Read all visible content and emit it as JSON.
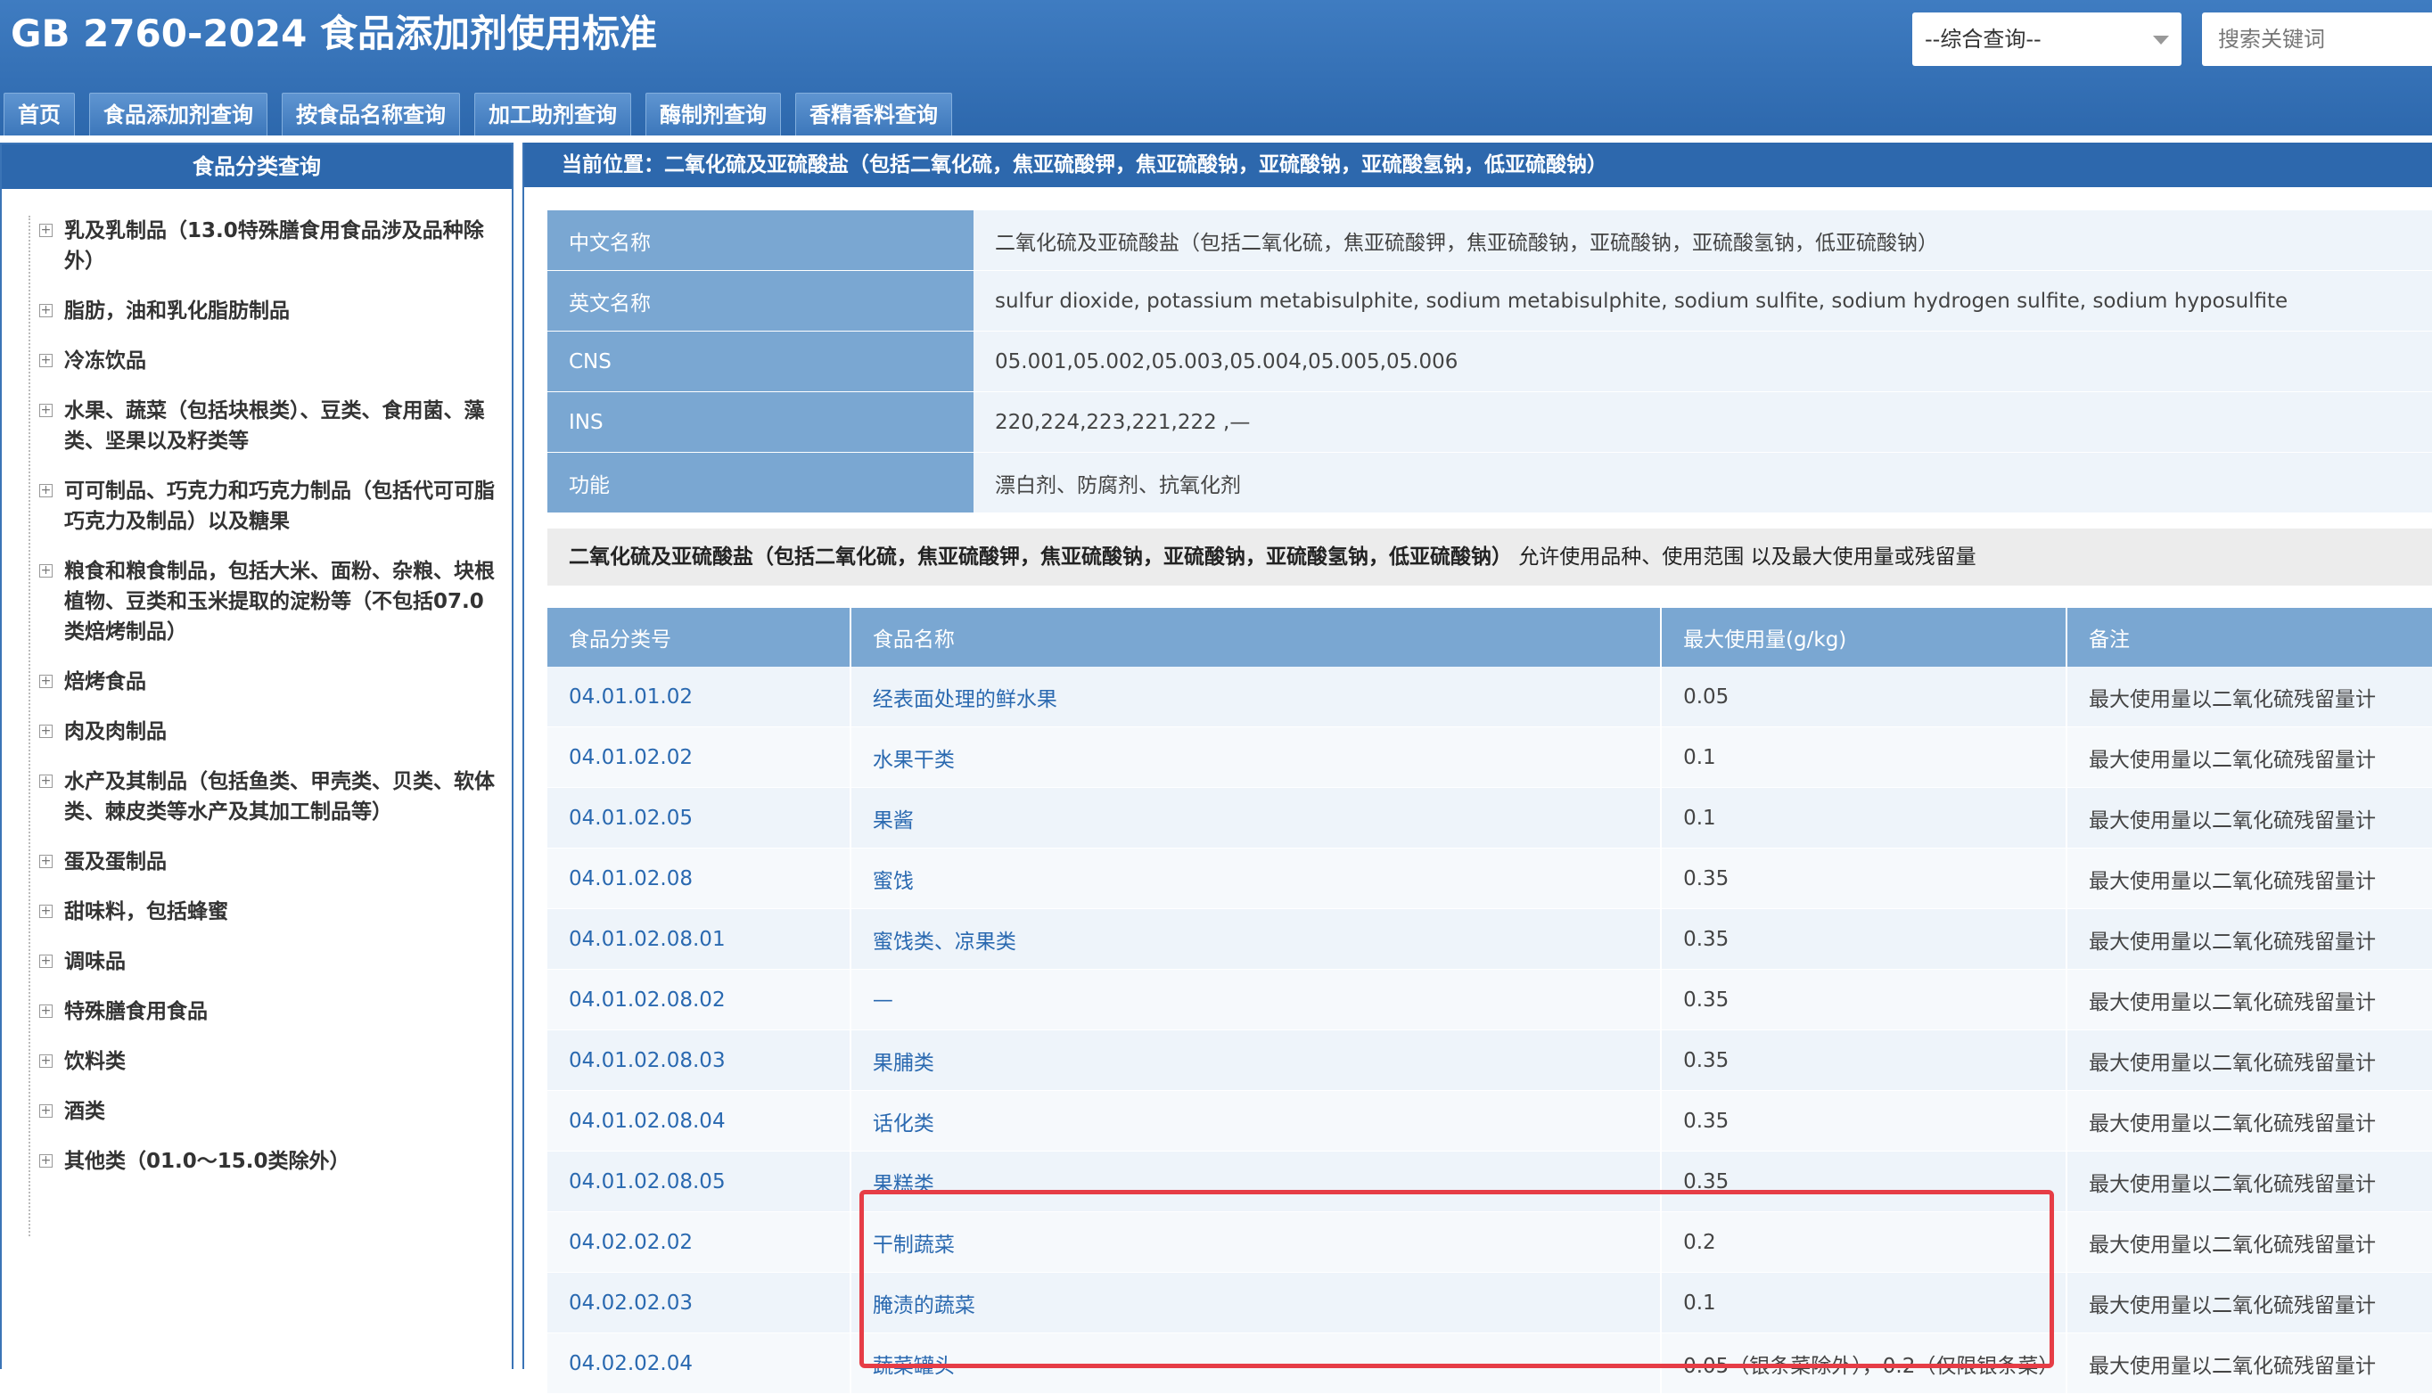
{
  "header": {
    "title": "GB 2760-2024 食品添加剂使用标准",
    "select_value": "--综合查询--",
    "search_placeholder": "搜索关键词"
  },
  "nav": [
    {
      "label": "首页"
    },
    {
      "label": "食品添加剂查询"
    },
    {
      "label": "按食品名称查询"
    },
    {
      "label": "加工助剂查询"
    },
    {
      "label": "酶制剂查询"
    },
    {
      "label": "香精香料查询"
    }
  ],
  "sidebar": {
    "title": "食品分类查询",
    "items": [
      {
        "label": "乳及乳制品（13.0特殊膳食用食品涉及品种除外）"
      },
      {
        "label": "脂肪，油和乳化脂肪制品"
      },
      {
        "label": "冷冻饮品"
      },
      {
        "label": "水果、蔬菜（包括块根类）、豆类、食用菌、藻类、坚果以及籽类等"
      },
      {
        "label": "可可制品、巧克力和巧克力制品（包括代可可脂巧克力及制品）以及糖果"
      },
      {
        "label": "粮食和粮食制品，包括大米、面粉、杂粮、块根植物、豆类和玉米提取的淀粉等（不包括07.0类焙烤制品）"
      },
      {
        "label": "焙烤食品"
      },
      {
        "label": "肉及肉制品"
      },
      {
        "label": "水产及其制品（包括鱼类、甲壳类、贝类、软体类、棘皮类等水产及其加工制品等）"
      },
      {
        "label": "蛋及蛋制品"
      },
      {
        "label": "甜味料，包括蜂蜜"
      },
      {
        "label": "调味品"
      },
      {
        "label": "特殊膳食用食品"
      },
      {
        "label": "饮料类"
      },
      {
        "label": "酒类"
      },
      {
        "label": "其他类（01.0～15.0类除外）"
      }
    ]
  },
  "breadcrumb": "当前位置：二氧化硫及亚硫酸盐（包括二氧化硫，焦亚硫酸钾，焦亚硫酸钠，亚硫酸钠，亚硫酸氢钠，低亚硫酸钠）",
  "info": [
    {
      "label": "中文名称",
      "value": "二氧化硫及亚硫酸盐（包括二氧化硫，焦亚硫酸钾，焦亚硫酸钠，亚硫酸钠，亚硫酸氢钠，低亚硫酸钠）"
    },
    {
      "label": "英文名称",
      "value": "sulfur dioxide, potassium metabisulphite, sodium metabisulphite, sodium sulfite, sodium hydrogen sulfite, sodium hyposulfite"
    },
    {
      "label": "CNS",
      "value": "05.001,05.002,05.003,05.004,05.005,05.006"
    },
    {
      "label": "INS",
      "value": "220,224,223,221,222 ,—"
    },
    {
      "label": "功能",
      "value": "漂白剂、防腐剂、抗氧化剂"
    }
  ],
  "section": {
    "bold": "二氧化硫及亚硫酸盐（包括二氧化硫，焦亚硫酸钾，焦亚硫酸钠，亚硫酸钠，亚硫酸氢钠，低亚硫酸钠）",
    "rest": " 允许使用品种、使用范围 以及最大使用量或残留量"
  },
  "table": {
    "headers": [
      "食品分类号",
      "食品名称",
      "最大使用量(g/kg)",
      "备注"
    ],
    "rows": [
      {
        "code": "04.01.01.02",
        "name": "经表面处理的鲜水果",
        "max": "0.05",
        "note": "最大使用量以二氧化硫残留量计"
      },
      {
        "code": "04.01.02.02",
        "name": "水果干类",
        "max": "0.1",
        "note": "最大使用量以二氧化硫残留量计"
      },
      {
        "code": "04.01.02.05",
        "name": "果酱",
        "max": "0.1",
        "note": "最大使用量以二氧化硫残留量计"
      },
      {
        "code": "04.01.02.08",
        "name": "蜜饯",
        "max": "0.35",
        "note": "最大使用量以二氧化硫残留量计"
      },
      {
        "code": "04.01.02.08.01",
        "name": "蜜饯类、凉果类",
        "max": "0.35",
        "note": "最大使用量以二氧化硫残留量计"
      },
      {
        "code": "04.01.02.08.02",
        "name": "—",
        "max": "0.35",
        "note": "最大使用量以二氧化硫残留量计"
      },
      {
        "code": "04.01.02.08.03",
        "name": "果脯类",
        "max": "0.35",
        "note": "最大使用量以二氧化硫残留量计"
      },
      {
        "code": "04.01.02.08.04",
        "name": "话化类",
        "max": "0.35",
        "note": "最大使用量以二氧化硫残留量计"
      },
      {
        "code": "04.01.02.08.05",
        "name": "果糕类",
        "max": "0.35",
        "note": "最大使用量以二氧化硫残留量计"
      },
      {
        "code": "04.02.02.02",
        "name": "干制蔬菜",
        "max": "0.2",
        "note": "最大使用量以二氧化硫残留量计"
      },
      {
        "code": "04.02.02.03",
        "name": "腌渍的蔬菜",
        "max": "0.1",
        "note": "最大使用量以二氧化硫残留量计"
      },
      {
        "code": "04.02.02.04",
        "name": "蔬菜罐头",
        "max": "0.05（银条菜除外），0.2（仅限银条菜）",
        "note": "最大使用量以二氧化硫残留量计"
      }
    ]
  },
  "colors": {
    "header_blue": "#3f7cc1",
    "label_blue": "#7aa7d2",
    "link_blue": "#2a69b0",
    "highlight_red": "#e63d46"
  }
}
